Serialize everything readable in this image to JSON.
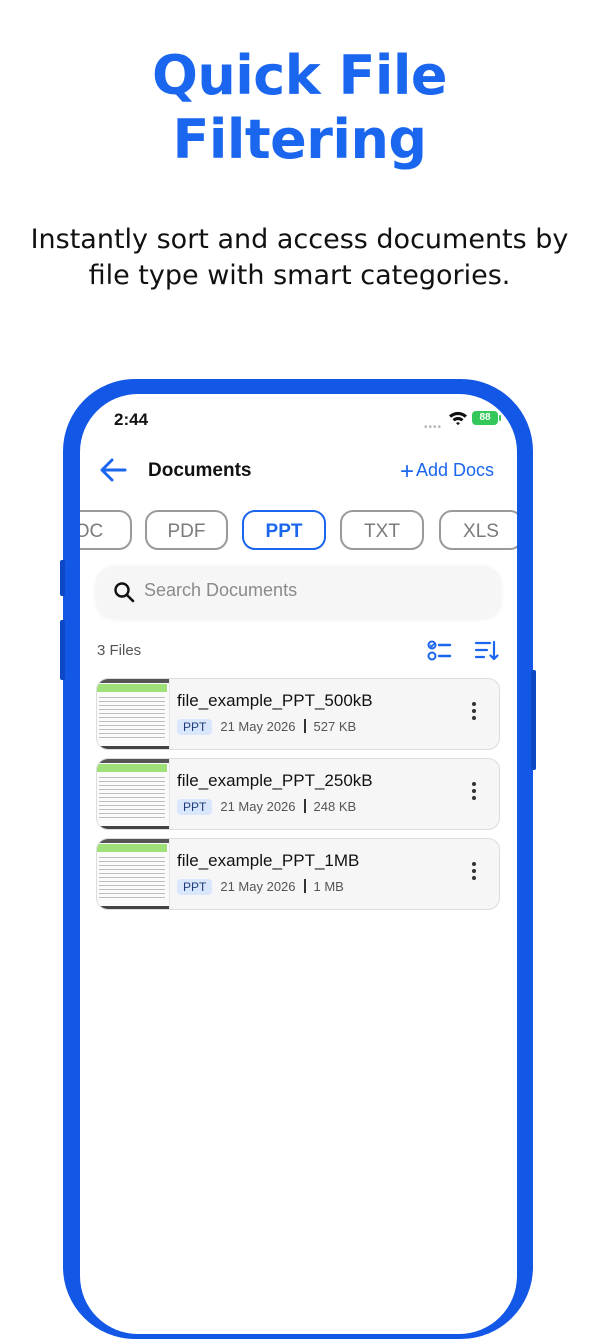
{
  "headline": {
    "line1": "Quick File",
    "line2": "Filtering"
  },
  "subline": {
    "line1": "Instantly sort and access documents by",
    "line2": "file type with smart categories."
  },
  "status_bar": {
    "time": "2:44",
    "battery": "88"
  },
  "appbar": {
    "title": "Documents",
    "add_docs": "Add Docs"
  },
  "filter_chips": [
    {
      "label": "OC",
      "active": false
    },
    {
      "label": "PDF",
      "active": false
    },
    {
      "label": "PPT",
      "active": true
    },
    {
      "label": "TXT",
      "active": false
    },
    {
      "label": "XLS",
      "active": false
    }
  ],
  "search": {
    "placeholder": "Search Documents"
  },
  "files": {
    "count_label": "3 Files",
    "items": [
      {
        "name": "file_example_PPT_500kB",
        "type": "PPT",
        "date": "21 May 2026",
        "size": "527 KB"
      },
      {
        "name": "file_example_PPT_250kB",
        "type": "PPT",
        "date": "21 May 2026",
        "size": "248 KB"
      },
      {
        "name": "file_example_PPT_1MB",
        "type": "PPT",
        "date": "21 May 2026",
        "size": "1 MB"
      }
    ]
  },
  "colors": {
    "accent": "#1a66ee",
    "frame": "#1257e6",
    "battery": "#34c759",
    "badge_bg": "#d9e6fb"
  },
  "icons": [
    "back-arrow-icon",
    "plus-icon",
    "search-icon",
    "select-list-icon",
    "sort-icon",
    "kebab-menu-icon",
    "wifi-icon",
    "battery-icon"
  ]
}
